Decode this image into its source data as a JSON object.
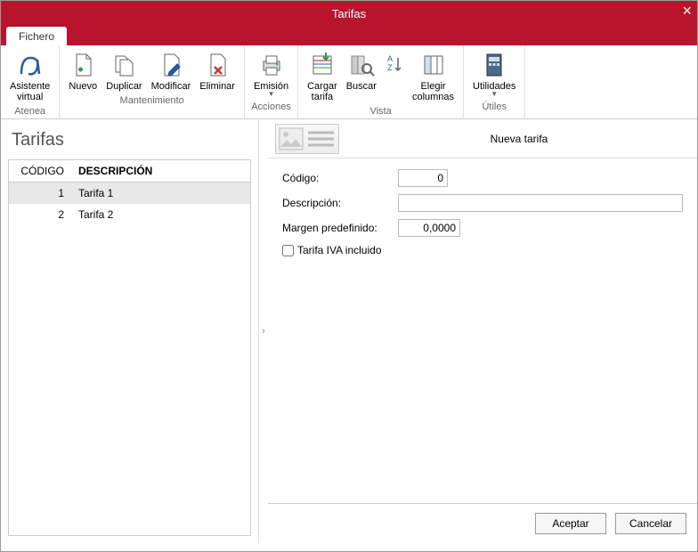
{
  "window": {
    "title": "Tarifas"
  },
  "tabs": {
    "file": "Fichero"
  },
  "ribbon": {
    "asistente": {
      "l1": "Asistente",
      "l2": "virtual",
      "group": "Atenea"
    },
    "nuevo": "Nuevo",
    "duplicar": "Duplicar",
    "modificar": "Modificar",
    "eliminar": "Eliminar",
    "mantenimiento": "Mantenimiento",
    "emision": "Emisión",
    "acciones": "Acciones",
    "cargar": {
      "l1": "Cargar",
      "l2": "tarifa"
    },
    "buscar": "Buscar",
    "elegir": {
      "l1": "Elegir",
      "l2": "columnas"
    },
    "vista": "Vista",
    "utilidades": "Utilidades",
    "utiles": "Útiles"
  },
  "left": {
    "heading": "Tarifas",
    "cols": {
      "codigo": "CÓDIGO",
      "descripcion": "DESCRIPCIÓN"
    },
    "rows": [
      {
        "code": "1",
        "desc": "Tarifa 1",
        "sel": true
      },
      {
        "code": "2",
        "desc": "Tarifa 2",
        "sel": false
      }
    ]
  },
  "detail": {
    "title": "Nueva tarifa",
    "codigo_lbl": "Código:",
    "codigo_val": "0",
    "desc_lbl": "Descripción:",
    "desc_val": "",
    "margen_lbl": "Margen predefinido:",
    "margen_val": "0,0000",
    "iva_lbl": "Tarifa IVA incluido"
  },
  "footer": {
    "ok": "Aceptar",
    "cancel": "Cancelar"
  }
}
